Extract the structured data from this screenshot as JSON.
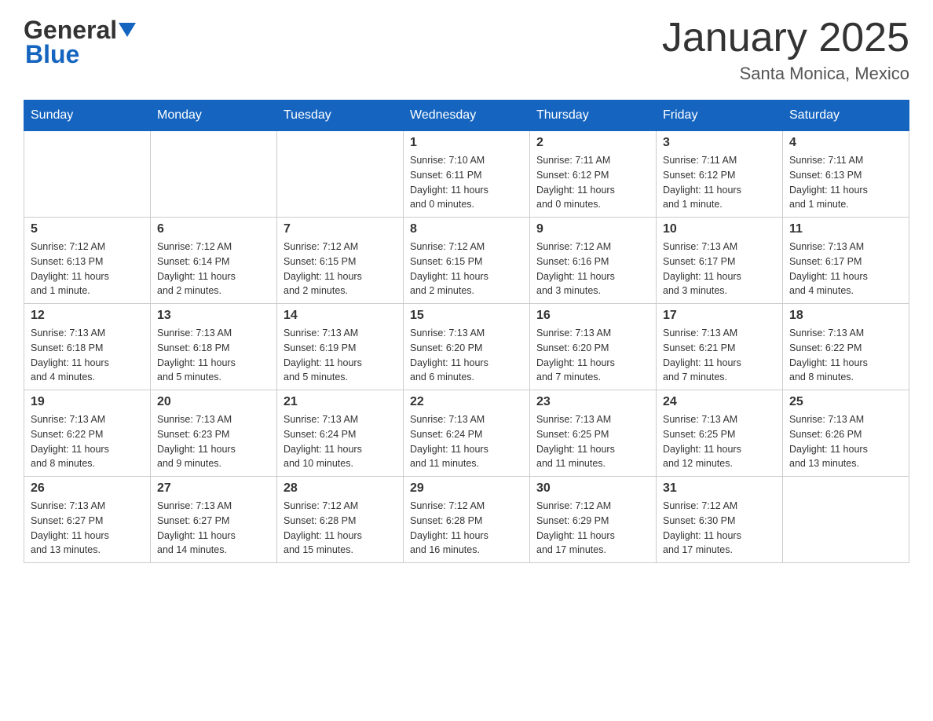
{
  "header": {
    "logo_general": "General",
    "logo_blue": "Blue",
    "month_title": "January 2025",
    "location": "Santa Monica, Mexico"
  },
  "days_of_week": [
    "Sunday",
    "Monday",
    "Tuesday",
    "Wednesday",
    "Thursday",
    "Friday",
    "Saturday"
  ],
  "weeks": [
    [
      {
        "day": "",
        "info": ""
      },
      {
        "day": "",
        "info": ""
      },
      {
        "day": "",
        "info": ""
      },
      {
        "day": "1",
        "info": "Sunrise: 7:10 AM\nSunset: 6:11 PM\nDaylight: 11 hours\nand 0 minutes."
      },
      {
        "day": "2",
        "info": "Sunrise: 7:11 AM\nSunset: 6:12 PM\nDaylight: 11 hours\nand 0 minutes."
      },
      {
        "day": "3",
        "info": "Sunrise: 7:11 AM\nSunset: 6:12 PM\nDaylight: 11 hours\nand 1 minute."
      },
      {
        "day": "4",
        "info": "Sunrise: 7:11 AM\nSunset: 6:13 PM\nDaylight: 11 hours\nand 1 minute."
      }
    ],
    [
      {
        "day": "5",
        "info": "Sunrise: 7:12 AM\nSunset: 6:13 PM\nDaylight: 11 hours\nand 1 minute."
      },
      {
        "day": "6",
        "info": "Sunrise: 7:12 AM\nSunset: 6:14 PM\nDaylight: 11 hours\nand 2 minutes."
      },
      {
        "day": "7",
        "info": "Sunrise: 7:12 AM\nSunset: 6:15 PM\nDaylight: 11 hours\nand 2 minutes."
      },
      {
        "day": "8",
        "info": "Sunrise: 7:12 AM\nSunset: 6:15 PM\nDaylight: 11 hours\nand 2 minutes."
      },
      {
        "day": "9",
        "info": "Sunrise: 7:12 AM\nSunset: 6:16 PM\nDaylight: 11 hours\nand 3 minutes."
      },
      {
        "day": "10",
        "info": "Sunrise: 7:13 AM\nSunset: 6:17 PM\nDaylight: 11 hours\nand 3 minutes."
      },
      {
        "day": "11",
        "info": "Sunrise: 7:13 AM\nSunset: 6:17 PM\nDaylight: 11 hours\nand 4 minutes."
      }
    ],
    [
      {
        "day": "12",
        "info": "Sunrise: 7:13 AM\nSunset: 6:18 PM\nDaylight: 11 hours\nand 4 minutes."
      },
      {
        "day": "13",
        "info": "Sunrise: 7:13 AM\nSunset: 6:18 PM\nDaylight: 11 hours\nand 5 minutes."
      },
      {
        "day": "14",
        "info": "Sunrise: 7:13 AM\nSunset: 6:19 PM\nDaylight: 11 hours\nand 5 minutes."
      },
      {
        "day": "15",
        "info": "Sunrise: 7:13 AM\nSunset: 6:20 PM\nDaylight: 11 hours\nand 6 minutes."
      },
      {
        "day": "16",
        "info": "Sunrise: 7:13 AM\nSunset: 6:20 PM\nDaylight: 11 hours\nand 7 minutes."
      },
      {
        "day": "17",
        "info": "Sunrise: 7:13 AM\nSunset: 6:21 PM\nDaylight: 11 hours\nand 7 minutes."
      },
      {
        "day": "18",
        "info": "Sunrise: 7:13 AM\nSunset: 6:22 PM\nDaylight: 11 hours\nand 8 minutes."
      }
    ],
    [
      {
        "day": "19",
        "info": "Sunrise: 7:13 AM\nSunset: 6:22 PM\nDaylight: 11 hours\nand 8 minutes."
      },
      {
        "day": "20",
        "info": "Sunrise: 7:13 AM\nSunset: 6:23 PM\nDaylight: 11 hours\nand 9 minutes."
      },
      {
        "day": "21",
        "info": "Sunrise: 7:13 AM\nSunset: 6:24 PM\nDaylight: 11 hours\nand 10 minutes."
      },
      {
        "day": "22",
        "info": "Sunrise: 7:13 AM\nSunset: 6:24 PM\nDaylight: 11 hours\nand 11 minutes."
      },
      {
        "day": "23",
        "info": "Sunrise: 7:13 AM\nSunset: 6:25 PM\nDaylight: 11 hours\nand 11 minutes."
      },
      {
        "day": "24",
        "info": "Sunrise: 7:13 AM\nSunset: 6:25 PM\nDaylight: 11 hours\nand 12 minutes."
      },
      {
        "day": "25",
        "info": "Sunrise: 7:13 AM\nSunset: 6:26 PM\nDaylight: 11 hours\nand 13 minutes."
      }
    ],
    [
      {
        "day": "26",
        "info": "Sunrise: 7:13 AM\nSunset: 6:27 PM\nDaylight: 11 hours\nand 13 minutes."
      },
      {
        "day": "27",
        "info": "Sunrise: 7:13 AM\nSunset: 6:27 PM\nDaylight: 11 hours\nand 14 minutes."
      },
      {
        "day": "28",
        "info": "Sunrise: 7:12 AM\nSunset: 6:28 PM\nDaylight: 11 hours\nand 15 minutes."
      },
      {
        "day": "29",
        "info": "Sunrise: 7:12 AM\nSunset: 6:28 PM\nDaylight: 11 hours\nand 16 minutes."
      },
      {
        "day": "30",
        "info": "Sunrise: 7:12 AM\nSunset: 6:29 PM\nDaylight: 11 hours\nand 17 minutes."
      },
      {
        "day": "31",
        "info": "Sunrise: 7:12 AM\nSunset: 6:30 PM\nDaylight: 11 hours\nand 17 minutes."
      },
      {
        "day": "",
        "info": ""
      }
    ]
  ]
}
